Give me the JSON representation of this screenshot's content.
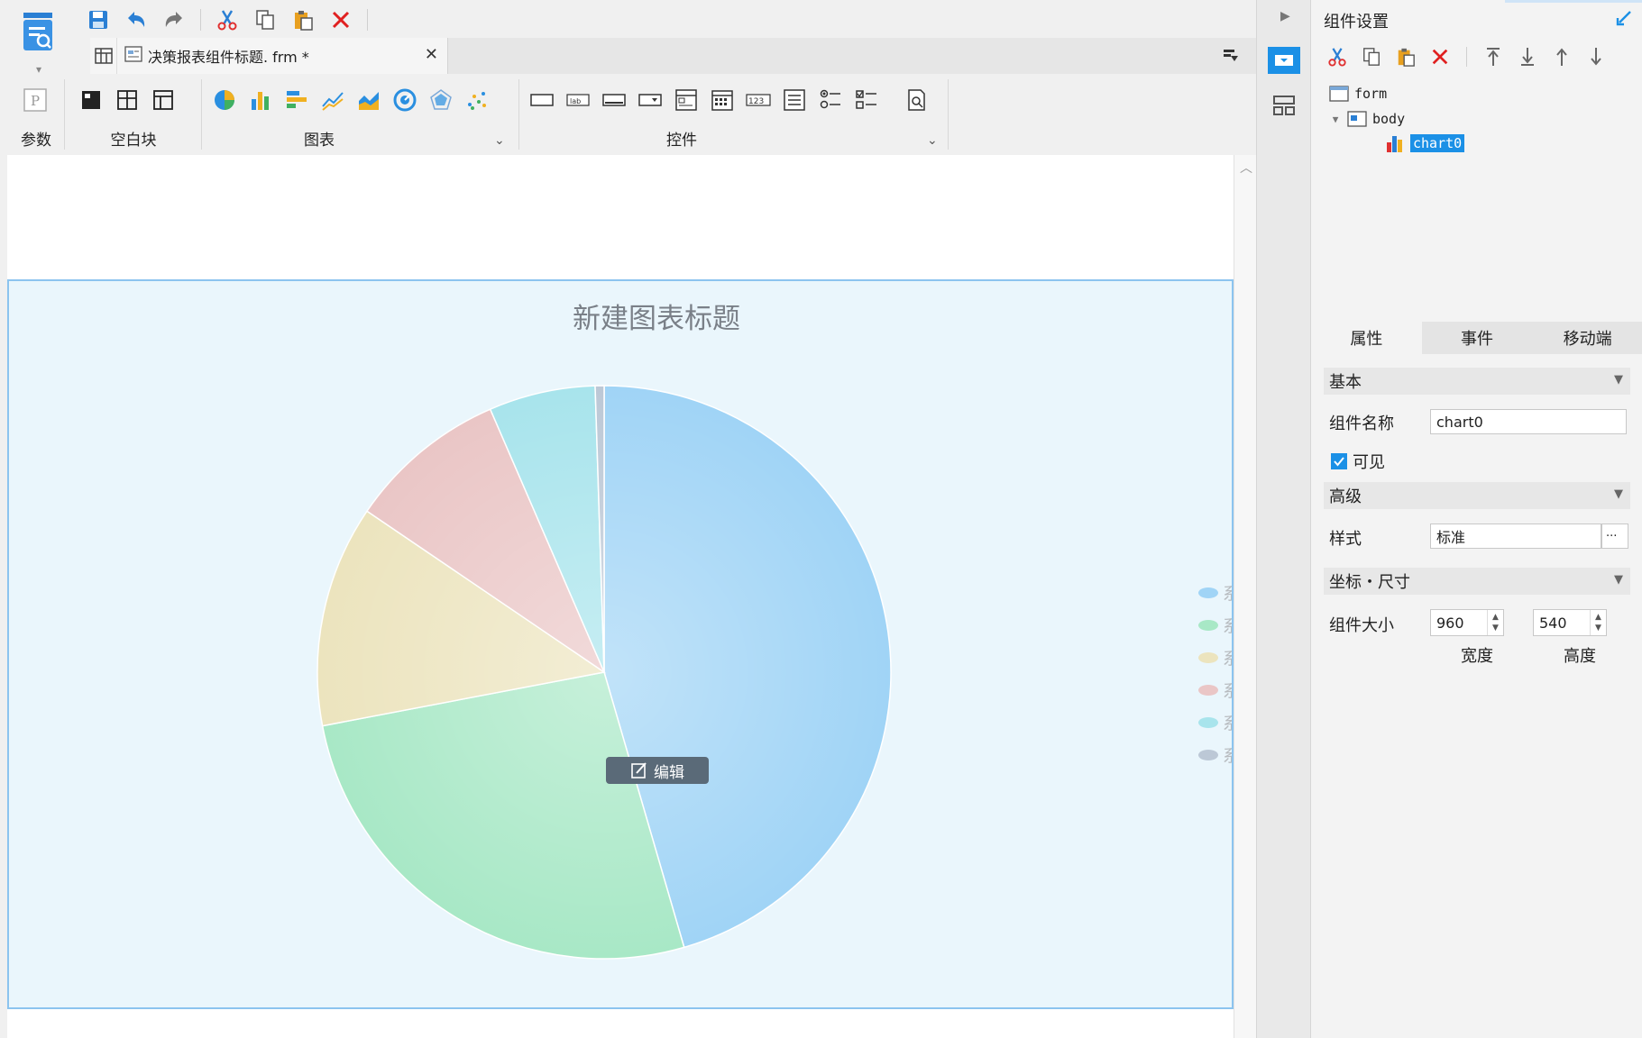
{
  "tab": {
    "title": "决策报表组件标题. frm *"
  },
  "ribbon": {
    "groups": [
      {
        "label": "参数"
      },
      {
        "label": "空白块"
      },
      {
        "label": "图表"
      },
      {
        "label": "控件"
      }
    ],
    "controls": [
      {
        "icon": "textbox-icon",
        "text": ""
      },
      {
        "icon": "label-icon",
        "text": "lab"
      },
      {
        "icon": "button-icon",
        "text": ""
      },
      {
        "icon": "combobox-icon",
        "text": ""
      },
      {
        "icon": "tabpane-icon",
        "text": ""
      },
      {
        "icon": "date-icon",
        "text": ""
      },
      {
        "icon": "number-icon",
        "text": "123"
      },
      {
        "icon": "list-icon",
        "text": ""
      },
      {
        "icon": "radiogroup-icon",
        "text": ""
      },
      {
        "icon": "checkboxgroup-icon",
        "text": ""
      }
    ]
  },
  "chart_data": {
    "type": "pie",
    "title": "新建图表标题",
    "series": [
      {
        "name": "",
        "value": 45.5,
        "color": "#a0d4f6"
      },
      {
        "name": "",
        "value": 26.5,
        "color": "#a8e8c6"
      },
      {
        "name": "",
        "value": 12.5,
        "color": "#ece4be"
      },
      {
        "name": "",
        "value": 9.0,
        "color": "#eac6c6"
      },
      {
        "name": "",
        "value": 6.0,
        "color": "#a8e4ec"
      },
      {
        "name": "",
        "value": 0.5,
        "color": "#bcc8d6"
      }
    ],
    "legend_position": "right",
    "legend_partial_text": "系"
  },
  "edit_badge": {
    "label": "编辑"
  },
  "right_panel": {
    "title": "组件设置",
    "tree": [
      {
        "label": "form",
        "level": 0
      },
      {
        "label": "body",
        "level": 1
      },
      {
        "label": "chart0",
        "level": 2,
        "selected": true
      }
    ],
    "tabs": [
      "属性",
      "事件",
      "移动端"
    ],
    "sections": {
      "basic": "基本",
      "advanced": "高级",
      "position_size": "坐标・尺寸"
    },
    "props": {
      "name_label": "组件名称",
      "name_value": "chart0",
      "visible_label": "可见",
      "visible_checked": true,
      "style_label": "样式",
      "style_value": "标准",
      "style_more": "···",
      "size_label": "组件大小",
      "width_value": "960",
      "height_value": "540",
      "width_label": "宽度",
      "height_label": "高度"
    }
  },
  "colors": {
    "accent": "#1b90e6",
    "chart_bg": "#eaf6fc",
    "chart_border": "#8cc4ef"
  }
}
